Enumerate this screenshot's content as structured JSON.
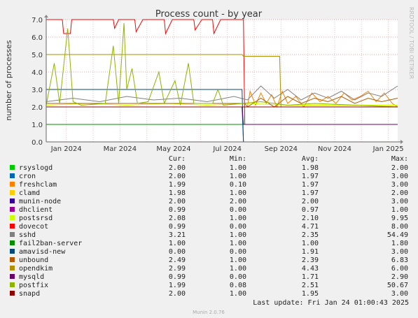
{
  "chart_data": {
    "type": "line",
    "title": "Process count - by year",
    "ylabel": "number of processes",
    "xlabel": "",
    "side_label": "RRDTOOL / TOBI OETIKER",
    "footer": "Munin 2.0.76",
    "last_update": "Last update: Fri Jan 24 01:00:43 2025",
    "ylim": [
      0,
      7
    ],
    "y_ticks": [
      "0.0",
      "1.0",
      "2.0",
      "3.0",
      "4.0",
      "5.0",
      "6.0",
      "7.0"
    ],
    "x_ticks": [
      "Jan 2024",
      "Mar 2024",
      "May 2024",
      "Jul 2024",
      "Sep 2024",
      "Nov 2024",
      "Jan 2025"
    ],
    "x_tick_months": [
      0.75,
      2.75,
      4.75,
      6.75,
      8.75,
      10.75,
      12.75
    ],
    "x_range_months": [
      0,
      13.1
    ],
    "grid": true,
    "legend_headers": {
      "cur": "Cur:",
      "min": "Min:",
      "avg": "Avg:",
      "max": "Max:"
    },
    "series": [
      {
        "name": "rsyslogd",
        "color": "#00cc00",
        "cur": "2.00",
        "min": "1.00",
        "avg": "1.98",
        "max": "2.00",
        "points": [
          [
            0,
            2
          ],
          [
            13.1,
            2
          ]
        ]
      },
      {
        "name": "cron",
        "color": "#0066b3",
        "cur": "2.00",
        "min": "1.00",
        "avg": "1.97",
        "max": "3.00",
        "points": [
          [
            0,
            2
          ],
          [
            7.3,
            2
          ],
          [
            7.35,
            0
          ],
          [
            13.1,
            0
          ]
        ]
      },
      {
        "name": "freshclam",
        "color": "#ff8000",
        "cur": "1.99",
        "min": "0.10",
        "avg": "1.97",
        "max": "3.00",
        "points": [
          [
            0,
            2
          ],
          [
            7.5,
            2
          ],
          [
            7.6,
            2.9
          ],
          [
            7.8,
            2.1
          ],
          [
            8.0,
            2.8
          ],
          [
            8.2,
            2.2
          ],
          [
            8.4,
            2.7
          ],
          [
            8.6,
            2.0
          ],
          [
            8.8,
            2.9
          ],
          [
            9.0,
            2.2
          ],
          [
            9.3,
            2.6
          ],
          [
            9.6,
            2.0
          ],
          [
            9.9,
            2.8
          ],
          [
            10.2,
            2.3
          ],
          [
            10.5,
            2.6
          ],
          [
            10.8,
            2.2
          ],
          [
            11.1,
            2.8
          ],
          [
            11.4,
            2.4
          ],
          [
            11.7,
            2.6
          ],
          [
            12.0,
            2.9
          ],
          [
            12.3,
            2.3
          ],
          [
            12.6,
            2.8
          ],
          [
            12.9,
            2.2
          ],
          [
            13.1,
            2.0
          ]
        ]
      },
      {
        "name": "clamd",
        "color": "#ffcc00",
        "cur": "1.98",
        "min": "1.00",
        "avg": "1.97",
        "max": "2.00",
        "points": [
          [
            0,
            2
          ],
          [
            13.1,
            2
          ]
        ]
      },
      {
        "name": "munin-node",
        "color": "#330099",
        "cur": "2.00",
        "min": "2.00",
        "avg": "2.00",
        "max": "3.00",
        "points": [
          [
            0,
            2
          ],
          [
            13.1,
            2
          ]
        ]
      },
      {
        "name": "dhclient",
        "color": "#990099",
        "cur": "0.99",
        "min": "0.00",
        "avg": "0.97",
        "max": "1.00",
        "points": [
          [
            0,
            1
          ],
          [
            13.1,
            1
          ]
        ]
      },
      {
        "name": "postsrsd",
        "color": "#ccff00",
        "cur": "2.08",
        "min": "1.00",
        "avg": "2.10",
        "max": "9.95",
        "points": [
          [
            0,
            2.1
          ],
          [
            1.5,
            2.2
          ],
          [
            3,
            2.1
          ],
          [
            4.5,
            2.2
          ],
          [
            6,
            2.1
          ],
          [
            7.5,
            2.2
          ],
          [
            9,
            2.1
          ],
          [
            10.5,
            2.1
          ],
          [
            13.1,
            2.1
          ]
        ]
      },
      {
        "name": "dovecot",
        "color": "#ff0000",
        "cur": "0.99",
        "min": "0.00",
        "avg": "4.71",
        "max": "8.00",
        "points": [
          [
            0,
            7
          ],
          [
            0.6,
            7
          ],
          [
            0.65,
            6.2
          ],
          [
            0.9,
            6.2
          ],
          [
            0.95,
            7
          ],
          [
            2.5,
            7
          ],
          [
            2.55,
            6.5
          ],
          [
            2.7,
            7
          ],
          [
            3.3,
            7
          ],
          [
            3.35,
            6.3
          ],
          [
            3.6,
            7
          ],
          [
            4.4,
            7
          ],
          [
            4.45,
            6.2
          ],
          [
            4.7,
            7
          ],
          [
            5.5,
            7
          ],
          [
            5.55,
            6.4
          ],
          [
            5.8,
            7
          ],
          [
            6.2,
            7
          ],
          [
            6.25,
            6.2
          ],
          [
            6.5,
            7
          ],
          [
            7.35,
            7
          ],
          [
            7.4,
            1
          ],
          [
            13.1,
            1
          ]
        ]
      },
      {
        "name": "sshd",
        "color": "#808080",
        "cur": "3.21",
        "min": "1.00",
        "avg": "2.35",
        "max": "54.49",
        "points": [
          [
            0,
            2.3
          ],
          [
            1,
            2.5
          ],
          [
            2,
            2.3
          ],
          [
            3,
            2.6
          ],
          [
            4,
            2.4
          ],
          [
            5,
            2.5
          ],
          [
            6,
            2.3
          ],
          [
            7,
            2.6
          ],
          [
            7.5,
            2.4
          ],
          [
            8,
            3.2
          ],
          [
            8.5,
            2.5
          ],
          [
            9,
            3.0
          ],
          [
            9.5,
            2.4
          ],
          [
            10,
            2.8
          ],
          [
            10.5,
            2.5
          ],
          [
            11,
            2.9
          ],
          [
            11.5,
            2.4
          ],
          [
            12,
            2.8
          ],
          [
            12.5,
            2.6
          ],
          [
            13.1,
            3.2
          ]
        ]
      },
      {
        "name": "fail2ban-server",
        "color": "#008f00",
        "cur": "1.00",
        "min": "1.00",
        "avg": "1.00",
        "max": "1.80",
        "points": [
          [
            0,
            1
          ],
          [
            13.1,
            1
          ]
        ]
      },
      {
        "name": "amavisd-new",
        "color": "#00487d",
        "cur": "0.00",
        "min": "0.00",
        "avg": "1.91",
        "max": "3.00",
        "points": [
          [
            0,
            3
          ],
          [
            7.3,
            3
          ],
          [
            7.35,
            0
          ],
          [
            13.1,
            0
          ]
        ]
      },
      {
        "name": "unbound",
        "color": "#b35a00",
        "cur": "2.49",
        "min": "1.00",
        "avg": "2.39",
        "max": "6.83",
        "points": [
          [
            0,
            2.2
          ],
          [
            7.4,
            2.2
          ],
          [
            7.5,
            2.0
          ],
          [
            8,
            2.5
          ],
          [
            8.5,
            2.0
          ],
          [
            9,
            2.6
          ],
          [
            9.5,
            2.2
          ],
          [
            10,
            2.5
          ],
          [
            10.5,
            2.3
          ],
          [
            11,
            2.6
          ],
          [
            11.5,
            2.2
          ],
          [
            12,
            2.5
          ],
          [
            12.5,
            2.3
          ],
          [
            13.1,
            2.5
          ]
        ]
      },
      {
        "name": "opendkim",
        "color": "#b38f00",
        "cur": "2.99",
        "min": "1.00",
        "avg": "4.43",
        "max": "6.00",
        "points": [
          [
            0,
            5
          ],
          [
            7.3,
            5
          ],
          [
            7.35,
            4.9
          ],
          [
            8.7,
            4.9
          ],
          [
            8.75,
            2.0
          ],
          [
            13.1,
            2.0
          ]
        ]
      },
      {
        "name": "mysqld",
        "color": "#6b006b",
        "cur": "0.99",
        "min": "0.00",
        "avg": "1.71",
        "max": "2.90",
        "points": [
          [
            0,
            2
          ],
          [
            7.3,
            2
          ],
          [
            7.35,
            1
          ],
          [
            13.1,
            1
          ]
        ]
      },
      {
        "name": "postfix",
        "color": "#8fb300",
        "cur": "1.99",
        "min": "0.08",
        "avg": "2.51",
        "max": "50.67",
        "points": [
          [
            0,
            2.1
          ],
          [
            0.3,
            4.5
          ],
          [
            0.5,
            2.2
          ],
          [
            0.8,
            6.5
          ],
          [
            1.0,
            2.3
          ],
          [
            1.3,
            2.1
          ],
          [
            2.2,
            2.2
          ],
          [
            2.5,
            5.5
          ],
          [
            2.7,
            2.2
          ],
          [
            2.9,
            6.8
          ],
          [
            3.0,
            3.0
          ],
          [
            3.2,
            4.2
          ],
          [
            3.4,
            2.2
          ],
          [
            3.8,
            2.3
          ],
          [
            4.2,
            4.0
          ],
          [
            4.4,
            2.2
          ],
          [
            4.8,
            3.5
          ],
          [
            5.0,
            2.1
          ],
          [
            5.3,
            4.5
          ],
          [
            5.5,
            2.2
          ],
          [
            6.2,
            2.2
          ],
          [
            6.4,
            3.0
          ],
          [
            6.6,
            2.1
          ],
          [
            7.3,
            2.2
          ],
          [
            8.0,
            2.3
          ],
          [
            9.0,
            2.1
          ],
          [
            10.0,
            2.2
          ],
          [
            13.1,
            2.0
          ]
        ]
      },
      {
        "name": "snapd",
        "color": "#8f0000",
        "cur": "2.00",
        "min": "1.00",
        "avg": "1.95",
        "max": "3.00",
        "points": [
          [
            0,
            2
          ],
          [
            13.1,
            2
          ]
        ]
      }
    ]
  }
}
